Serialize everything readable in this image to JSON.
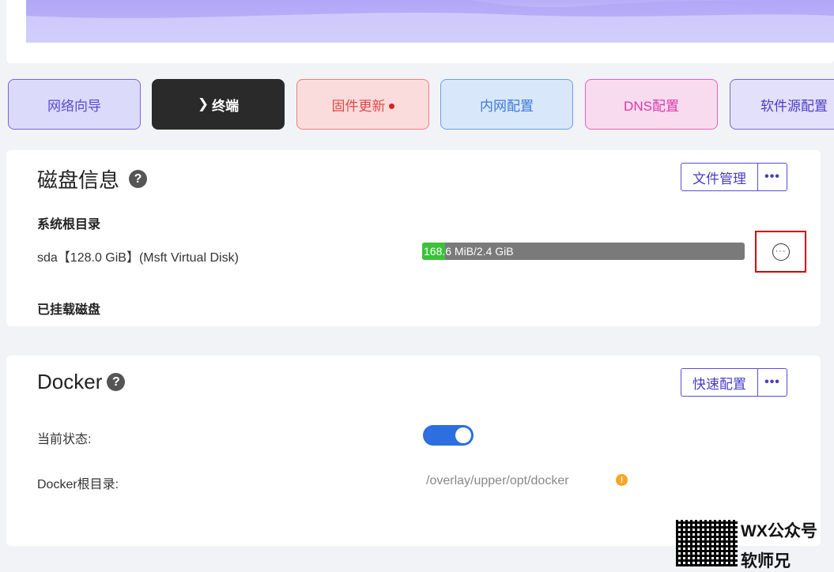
{
  "quick_actions": [
    {
      "label": "网络向导",
      "dot": false,
      "chevron": false
    },
    {
      "label": "终端",
      "dot": false,
      "chevron": true
    },
    {
      "label": "固件更新",
      "dot": true,
      "chevron": false
    },
    {
      "label": "内网配置",
      "dot": false,
      "chevron": false
    },
    {
      "label": "DNS配置",
      "dot": false,
      "chevron": false
    },
    {
      "label": "软件源配置",
      "dot": false,
      "chevron": false
    }
  ],
  "disk_card": {
    "title": "磁盘信息",
    "help": "?",
    "file_manager_label": "文件管理",
    "more_label": "•••",
    "root_section": "系统根目录",
    "disk_name": "sda【128.0 GiB】(Msft Virtual Disk)",
    "usage_text": "168.6 MiB/2.4 GiB",
    "usage_fraction": 0.07,
    "row_menu": "···",
    "mounted_section": "已挂载磁盘"
  },
  "docker_card": {
    "title": "Docker",
    "help": "?",
    "quick_config_label": "快速配置",
    "more_label": "•••",
    "status_label": "当前状态:",
    "status_on": true,
    "root_label": "Docker根目录:",
    "root_value": "/overlay/upper/opt/docker",
    "warn": "!"
  },
  "watermark": {
    "line1": "WX公众号",
    "line2": "软师兄"
  },
  "colors": {
    "accent": "#5b4bd6",
    "bar_fill": "#3bc23a",
    "toggle_on": "#2d6ee0",
    "highlight_box": "#d40000"
  }
}
